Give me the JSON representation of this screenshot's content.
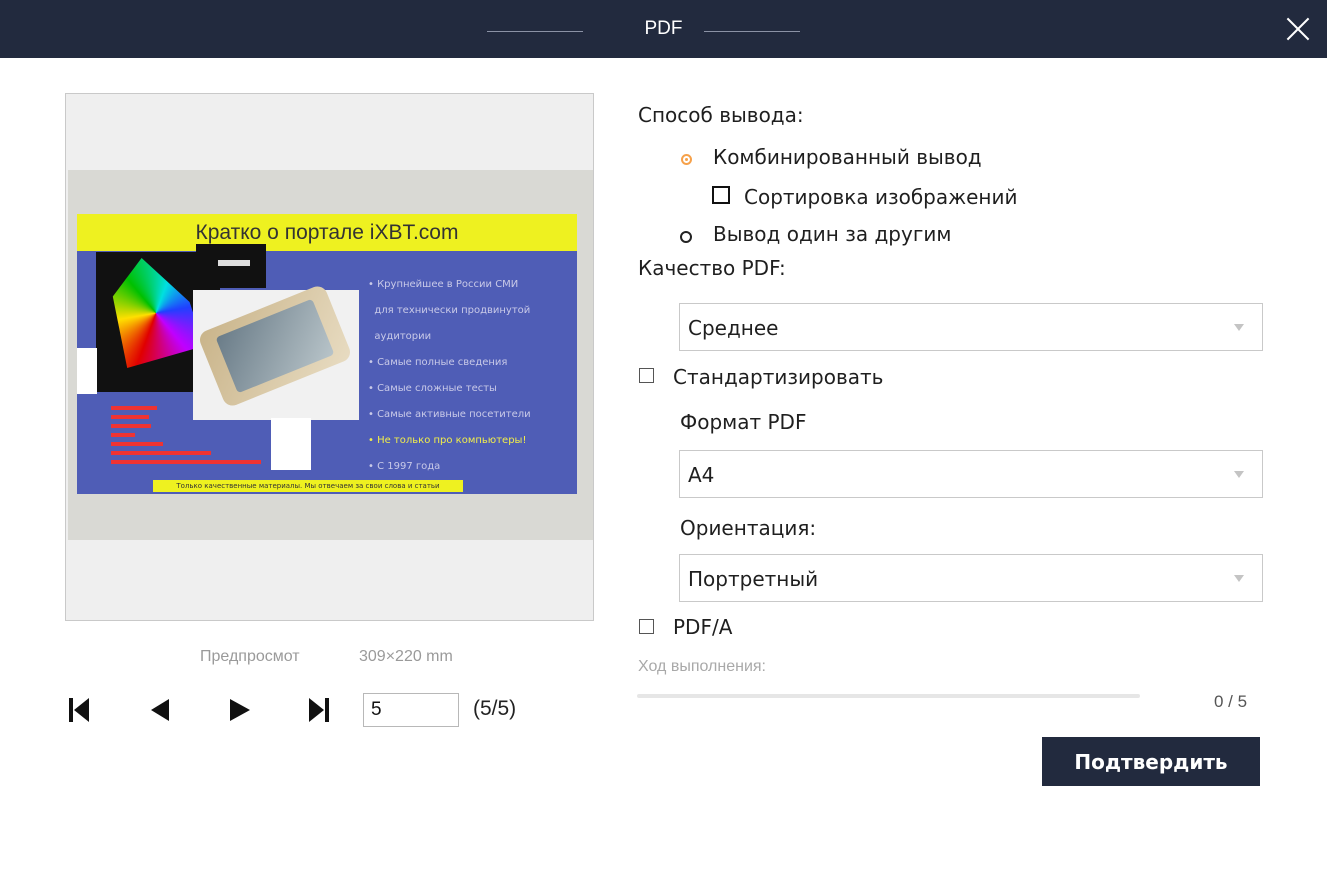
{
  "window": {
    "title": "PDF"
  },
  "preview": {
    "slide_title": "Кратко о портале iXBT.com",
    "slide_bullets": [
      "Крупнейшее в России СМИ",
      "для технически продвинутой",
      "аудитории",
      "Самые полные сведения",
      "Самые сложные тесты",
      "Самые активные посетители",
      "Не только про компьютеры!",
      "С 1997 года"
    ],
    "slide_footer": "Только качественные материалы. Мы отвечаем за свои слова и статьи",
    "label": "Предпросмот",
    "size": "309×220 mm"
  },
  "navigation": {
    "page_value": "5",
    "page_count": "(5/5)"
  },
  "output": {
    "heading": "Способ вывода:",
    "combined_label": "Комбинированный вывод",
    "sort_images_label": "Сортировка изображений",
    "sequential_label": "Вывод один за другим",
    "selected": "combined"
  },
  "quality": {
    "heading": "Качество PDF:",
    "value": "Среднее"
  },
  "standardize": {
    "label": "Стандартизировать",
    "checked": false
  },
  "format": {
    "heading": "Формат PDF",
    "value": "A4"
  },
  "orientation": {
    "heading": "Ориентация:",
    "value": "Портретный"
  },
  "pdfa": {
    "label": "PDF/A",
    "checked": false
  },
  "progress": {
    "label": "Ход выполнения:",
    "value": 0,
    "count": "0 / 5"
  },
  "confirm_label": "Подтвердить",
  "colors": {
    "titlebar": "#222a3e",
    "accent_radio": "#f6a14a",
    "button": "#222a3e"
  }
}
